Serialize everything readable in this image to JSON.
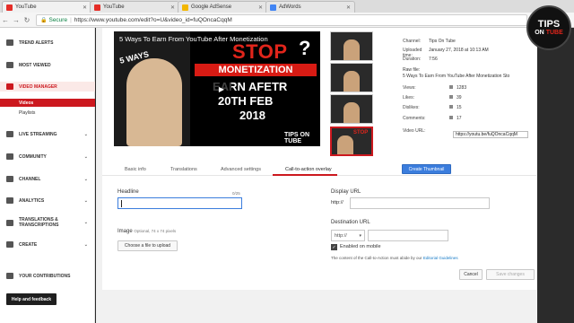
{
  "browser": {
    "tabs": [
      {
        "title": "YouTube",
        "fav": "youtube"
      },
      {
        "title": "YouTube",
        "fav": "youtube"
      },
      {
        "title": "Google AdSense",
        "fav": "adsense"
      },
      {
        "title": "AdWords",
        "fav": "adwords"
      }
    ],
    "secure_label": "Secure",
    "url": "https://www.youtube.com/edit?o=U&video_id=fuQOncaCqqM"
  },
  "sidebar": {
    "items": [
      {
        "label": "TREND ALERTS",
        "icon": "trend-alerts-icon"
      },
      {
        "label": "MOST VIEWED",
        "icon": "most-viewed-icon"
      },
      {
        "label": "VIDEO MANAGER",
        "icon": "video-manager-icon"
      },
      {
        "label": "LIVE STREAMING",
        "icon": "live-streaming-icon"
      },
      {
        "label": "COMMUNITY",
        "icon": "community-icon"
      },
      {
        "label": "CHANNEL",
        "icon": "channel-icon"
      },
      {
        "label": "ANALYTICS",
        "icon": "analytics-icon"
      },
      {
        "label": "TRANSLATIONS & TRANSCRIPTIONS",
        "icon": "translations-icon"
      },
      {
        "label": "CREATE",
        "icon": "create-icon"
      },
      {
        "label": "YOUR CONTRIBUTIONS",
        "icon": "contributions-icon"
      }
    ],
    "sub_items": [
      "Videos",
      "Playlists"
    ],
    "help_button": "Help and feedback"
  },
  "video": {
    "title": "5 Ways To Earn From YouTube After Monetization",
    "overlay_ways": "5 WAYS",
    "overlay_stop": "STOP",
    "overlay_monetization": "MONETIZATION",
    "overlay_earn": "EARN AFETR",
    "overlay_date": "20TH FEB",
    "overlay_year": "2018",
    "watermark": "TIPS ON TUBE"
  },
  "info": {
    "channel_label": "Channel:",
    "channel": "Tips On Tube",
    "uploaded_label": "Uploaded time:",
    "uploaded": "January 27, 2018 at 10:13 AM",
    "duration_label": "Duration:",
    "duration": "7:56",
    "raw_label": "Raw file:",
    "raw": "5 Ways To Earn From YouTube After Monetization Sto",
    "views_label": "Views:",
    "views": "1283",
    "likes_label": "Likes:",
    "likes": "39",
    "dislikes_label": "Dislikes:",
    "dislikes": "15",
    "comments_label": "Comments:",
    "comments": "17",
    "url_label": "Video URL:",
    "url": "https://youtu.be/fuQOncaCqqM"
  },
  "editor_tabs": [
    "Basic info",
    "Translations",
    "Advanced settings",
    "Call-to-action overlay"
  ],
  "create_thumbnail": "Create Thumbnail",
  "form": {
    "headline_label": "Headline",
    "headline_count": "0/25",
    "headline_value": "",
    "image_label": "Image",
    "image_hint": "Optional, 74 x 74 pixels",
    "choose_file": "Choose a file to upload",
    "display_url_label": "Display URL",
    "display_url_prefix": "http://",
    "destination_url_label": "Destination URL",
    "destination_select": "http://",
    "enabled_mobile": "Enabled on mobile",
    "policy_text": "The content of the Call-to-Action must abide by our",
    "policy_link": "Editorial Guidelines",
    "cancel": "Cancel",
    "save": "Save changes"
  },
  "logo": {
    "line1": "TIPS",
    "line2a": "ON",
    "line2b": "TUBE"
  }
}
